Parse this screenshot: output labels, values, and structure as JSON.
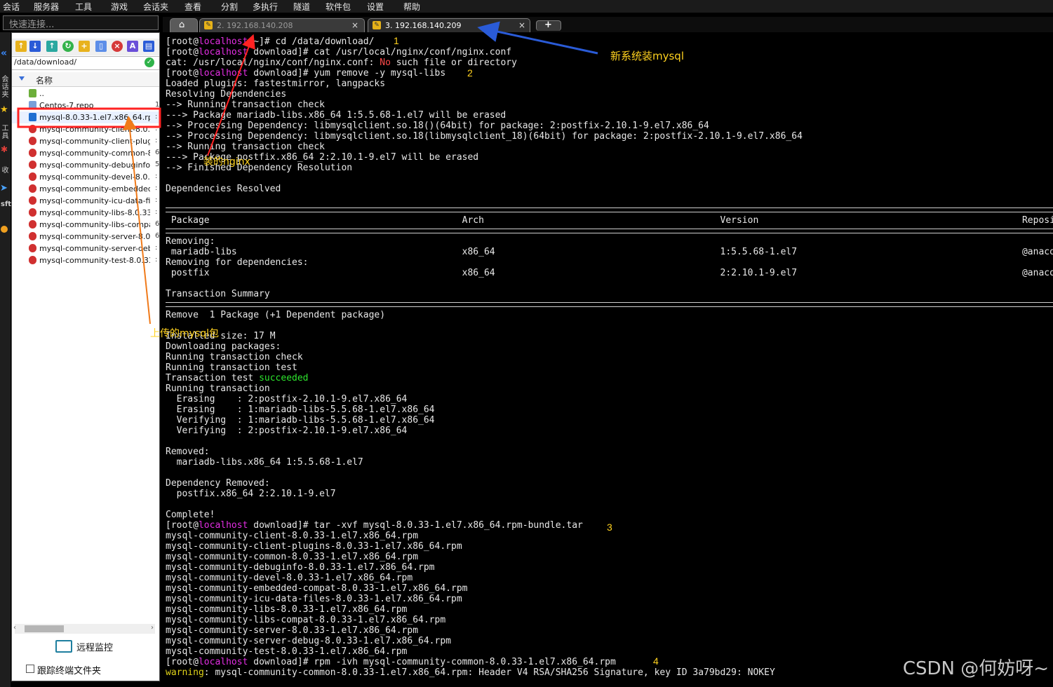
{
  "menu": [
    "会话",
    "服务器",
    "工具",
    "游戏",
    "会话夹",
    "查看",
    "分割",
    "多执行",
    "隧道",
    "软件包",
    "设置",
    "帮助"
  ],
  "quick_connect_placeholder": "快速连接...",
  "side_strip": [
    "会话夹",
    "工具",
    "收",
    "sftp"
  ],
  "file_panel": {
    "path": "/data/download/",
    "column_name": "名称",
    "files": [
      {
        "name": "..",
        "icon": "parent-folder-icon",
        "mark": ""
      },
      {
        "name": "Centos-7.repo",
        "icon": "file-icon",
        "mark": "1"
      },
      {
        "name": "mysql-8.0.33-1.el7.x86_64.rp...",
        "icon": "archive-icon",
        "mark": ":",
        "highlighted": true
      },
      {
        "name": "mysql-community-client-8.0.3...",
        "icon": "rpm-icon",
        "mark": ":"
      },
      {
        "name": "mysql-community-client-plugin...",
        "icon": "rpm-icon",
        "mark": ":"
      },
      {
        "name": "mysql-community-common-8.0...",
        "icon": "rpm-icon",
        "mark": "6"
      },
      {
        "name": "mysql-community-debuginfo-8...",
        "icon": "rpm-icon",
        "mark": "5"
      },
      {
        "name": "mysql-community-devel-8.0.3...",
        "icon": "rpm-icon",
        "mark": ":"
      },
      {
        "name": "mysql-community-embedded-c...",
        "icon": "rpm-icon",
        "mark": ":"
      },
      {
        "name": "mysql-community-icu-data-fil...",
        "icon": "rpm-icon",
        "mark": ":"
      },
      {
        "name": "mysql-community-libs-8.0.33...",
        "icon": "rpm-icon",
        "mark": ":"
      },
      {
        "name": "mysql-community-libs-compat...",
        "icon": "rpm-icon",
        "mark": "6"
      },
      {
        "name": "mysql-community-server-8.0...",
        "icon": "rpm-icon",
        "mark": "6"
      },
      {
        "name": "mysql-community-server-debu...",
        "icon": "rpm-icon",
        "mark": ":"
      },
      {
        "name": "mysql-community-test-8.0.33-...",
        "icon": "rpm-icon",
        "mark": ":"
      }
    ],
    "remote_monitor": "远程监控",
    "follow_terminal": "跟踪终端文件夹"
  },
  "tabs": [
    {
      "title": "2. 192.168.140.208",
      "active": false
    },
    {
      "title": "3. 192.168.140.209",
      "active": true
    }
  ],
  "terminal": {
    "lines": [
      [
        {
          "t": "[root@"
        },
        {
          "t": "localhost",
          "c": "mag"
        },
        {
          "t": " ~]# cd /data/download/"
        }
      ],
      [
        {
          "t": "[root@"
        },
        {
          "t": "localhost",
          "c": "mag"
        },
        {
          "t": " download]# cat /usr/local/nginx/conf/nginx.conf"
        }
      ],
      [
        {
          "t": "cat: /usr/local/nginx/conf/nginx.conf: "
        },
        {
          "t": "No",
          "c": "red"
        },
        {
          "t": " such file or directory"
        }
      ],
      [
        {
          "t": "[root@"
        },
        {
          "t": "localhost",
          "c": "mag"
        },
        {
          "t": " download]# yum remove -y mysql-libs"
        }
      ],
      [
        {
          "t": "Loaded plugins: fastestmirror, langpacks"
        }
      ],
      [
        {
          "t": "Resolving Dependencies"
        }
      ],
      [
        {
          "t": "--> Running transaction check"
        }
      ],
      [
        {
          "t": "---> Package mariadb-libs.x86_64 1:5.5.68-1.el7 will be erased"
        }
      ],
      [
        {
          "t": "--> Processing Dependency: libmysqlclient.so.18()(64bit) for package: 2:postfix-2.10.1-9.el7.x86_64"
        }
      ],
      [
        {
          "t": "--> Processing Dependency: libmysqlclient.so.18(libmysqlclient_18)(64bit) for package: 2:postfix-2.10.1-9.el7.x86_64"
        }
      ],
      [
        {
          "t": "--> Running transaction check"
        }
      ],
      [
        {
          "t": "---> Package postfix.x86_64 2:2.10.1-9.el7 will be erased"
        }
      ],
      [
        {
          "t": "--> Finished Dependency Resolution"
        }
      ],
      [
        {
          "t": ""
        }
      ],
      [
        {
          "t": "Dependencies Resolved"
        }
      ],
      [
        {
          "t": ""
        }
      ],
      [
        {
          "t": "",
          "sep": true
        }
      ],
      [
        {
          "t": " Package                                              Arch                                           Version                                                Reposi"
        }
      ],
      [
        {
          "t": "",
          "sep": true
        }
      ],
      [
        {
          "t": "Removing:"
        }
      ],
      [
        {
          "t": " mariadb-libs                                         x86_64                                         1:5.5.68-1.el7                                         @anaco"
        }
      ],
      [
        {
          "t": "Removing for dependencies:"
        }
      ],
      [
        {
          "t": " postfix                                              x86_64                                         2:2.10.1-9.el7                                         @anaco"
        }
      ],
      [
        {
          "t": ""
        }
      ],
      [
        {
          "t": "Transaction Summary"
        }
      ],
      [
        {
          "t": "",
          "sep": true
        }
      ],
      [
        {
          "t": "Remove  1 Package (+1 Dependent package)"
        }
      ],
      [
        {
          "t": ""
        }
      ],
      [
        {
          "t": "Installed size: 17 M"
        }
      ],
      [
        {
          "t": "Downloading packages:"
        }
      ],
      [
        {
          "t": "Running transaction check"
        }
      ],
      [
        {
          "t": "Running transaction test"
        }
      ],
      [
        {
          "t": "Transaction test "
        },
        {
          "t": "succeeded",
          "c": "grn"
        }
      ],
      [
        {
          "t": "Running transaction"
        }
      ],
      [
        {
          "t": "  Erasing    : 2:postfix-2.10.1-9.el7.x86_64"
        }
      ],
      [
        {
          "t": "  Erasing    : 1:mariadb-libs-5.5.68-1.el7.x86_64"
        }
      ],
      [
        {
          "t": "  Verifying  : 1:mariadb-libs-5.5.68-1.el7.x86_64"
        }
      ],
      [
        {
          "t": "  Verifying  : 2:postfix-2.10.1-9.el7.x86_64"
        }
      ],
      [
        {
          "t": ""
        }
      ],
      [
        {
          "t": "Removed:"
        }
      ],
      [
        {
          "t": "  mariadb-libs.x86_64 1:5.5.68-1.el7"
        }
      ],
      [
        {
          "t": ""
        }
      ],
      [
        {
          "t": "Dependency Removed:"
        }
      ],
      [
        {
          "t": "  postfix.x86_64 2:2.10.1-9.el7"
        }
      ],
      [
        {
          "t": ""
        }
      ],
      [
        {
          "t": "Complete!"
        }
      ],
      [
        {
          "t": "[root@"
        },
        {
          "t": "localhost",
          "c": "mag"
        },
        {
          "t": " download]# tar -xvf mysql-8.0.33-1.el7.x86_64.rpm-bundle.tar"
        }
      ],
      [
        {
          "t": "mysql-community-client-8.0.33-1.el7.x86_64.rpm"
        }
      ],
      [
        {
          "t": "mysql-community-client-plugins-8.0.33-1.el7.x86_64.rpm"
        }
      ],
      [
        {
          "t": "mysql-community-common-8.0.33-1.el7.x86_64.rpm"
        }
      ],
      [
        {
          "t": "mysql-community-debuginfo-8.0.33-1.el7.x86_64.rpm"
        }
      ],
      [
        {
          "t": "mysql-community-devel-8.0.33-1.el7.x86_64.rpm"
        }
      ],
      [
        {
          "t": "mysql-community-embedded-compat-8.0.33-1.el7.x86_64.rpm"
        }
      ],
      [
        {
          "t": "mysql-community-icu-data-files-8.0.33-1.el7.x86_64.rpm"
        }
      ],
      [
        {
          "t": "mysql-community-libs-8.0.33-1.el7.x86_64.rpm"
        }
      ],
      [
        {
          "t": "mysql-community-libs-compat-8.0.33-1.el7.x86_64.rpm"
        }
      ],
      [
        {
          "t": "mysql-community-server-8.0.33-1.el7.x86_64.rpm"
        }
      ],
      [
        {
          "t": "mysql-community-server-debug-8.0.33-1.el7.x86_64.rpm"
        }
      ],
      [
        {
          "t": "mysql-community-test-8.0.33-1.el7.x86_64.rpm"
        }
      ],
      [
        {
          "t": "[root@"
        },
        {
          "t": "localhost",
          "c": "mag"
        },
        {
          "t": " download]# rpm -ivh mysql-community-common-8.0.33-1.el7.x86_64.rpm"
        }
      ],
      [
        {
          "t": "warning",
          "c": "ylw"
        },
        {
          "t": ": mysql-community-common-8.0.33-1.el7.x86_64.rpm: Header V4 RSA/SHA256 Signature, key ID 3a79bd29: NOKEY"
        }
      ]
    ]
  },
  "annotations": {
    "step1": "1",
    "step2": "2",
    "step3": "3",
    "step4": "4",
    "new_system": "新系统装mysql",
    "installed_nginx": "装的nginx",
    "uploaded_pkg": "上传的mysql包",
    "colors": {
      "red": "#ff2222",
      "blue": "#2a5bd7",
      "orange": "#f07a1a",
      "yellow": "#ffd21f"
    }
  },
  "watermark": "CSDN @何妨呀~"
}
